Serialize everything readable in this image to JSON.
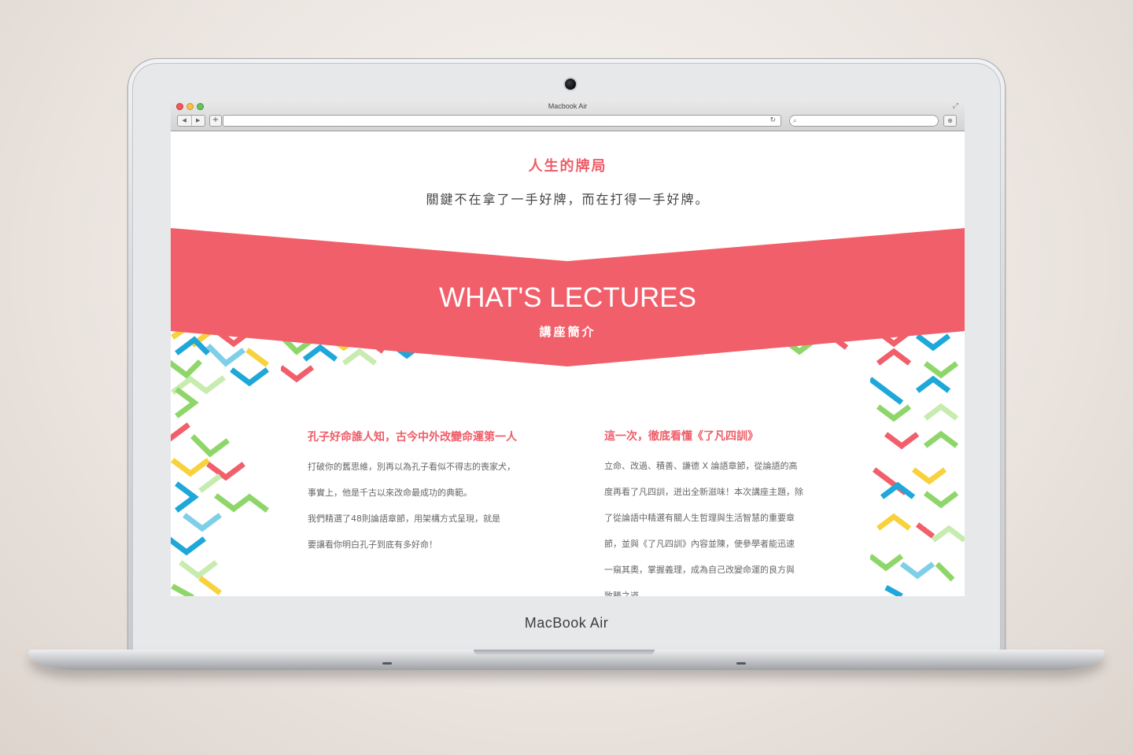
{
  "browser": {
    "window_title": "Macbook Air",
    "back_label": "◀",
    "forward_label": "▶",
    "new_tab_label": "+",
    "reload_icon": "↻",
    "search_icon": "⌕",
    "download_icon": "⊕",
    "fullscreen_icon": "⤢"
  },
  "device": {
    "brand_label": "MacBook Air"
  },
  "page": {
    "headline": "人生的牌局",
    "subline": "關鍵不在拿了一手好牌，而在打得一手好牌。",
    "banner": {
      "title_en": "WHAT'S LECTURES",
      "title_zh": "講座簡介",
      "color": "#f15f6b"
    },
    "left_column": {
      "heading": "孔子好命誰人知，古今中外改變命運第一人",
      "lines": [
        "打破你的舊思維，別再以為孔子看似不得志的喪家犬，",
        "事實上，他是千古以來改命最成功的典範。",
        "我們精選了48則論語章節，用架構方式呈現，就是",
        "要讓看你明白孔子到底有多好命！"
      ]
    },
    "right_column": {
      "heading": "這一次，徹底看懂《了凡四訓》",
      "lines": [
        "立命、改過、積善、謙德 X 論語章節，從論語的高",
        "度再看了凡四訓，迸出全新滋味！本次講座主題，除",
        "了從論語中精選有關人生哲理與生活智慧的重要章",
        "節，並與《了凡四訓》內容並陳，使參學者能迅速",
        "一窺其奧，掌握義理，成為自己改變命運的良方與",
        "致勝之道。"
      ]
    },
    "pattern_colors": [
      "#8fd66a",
      "#1ea7d9",
      "#f15f6b",
      "#f8d23c",
      "#c8ecb0",
      "#7fcfe8"
    ]
  }
}
